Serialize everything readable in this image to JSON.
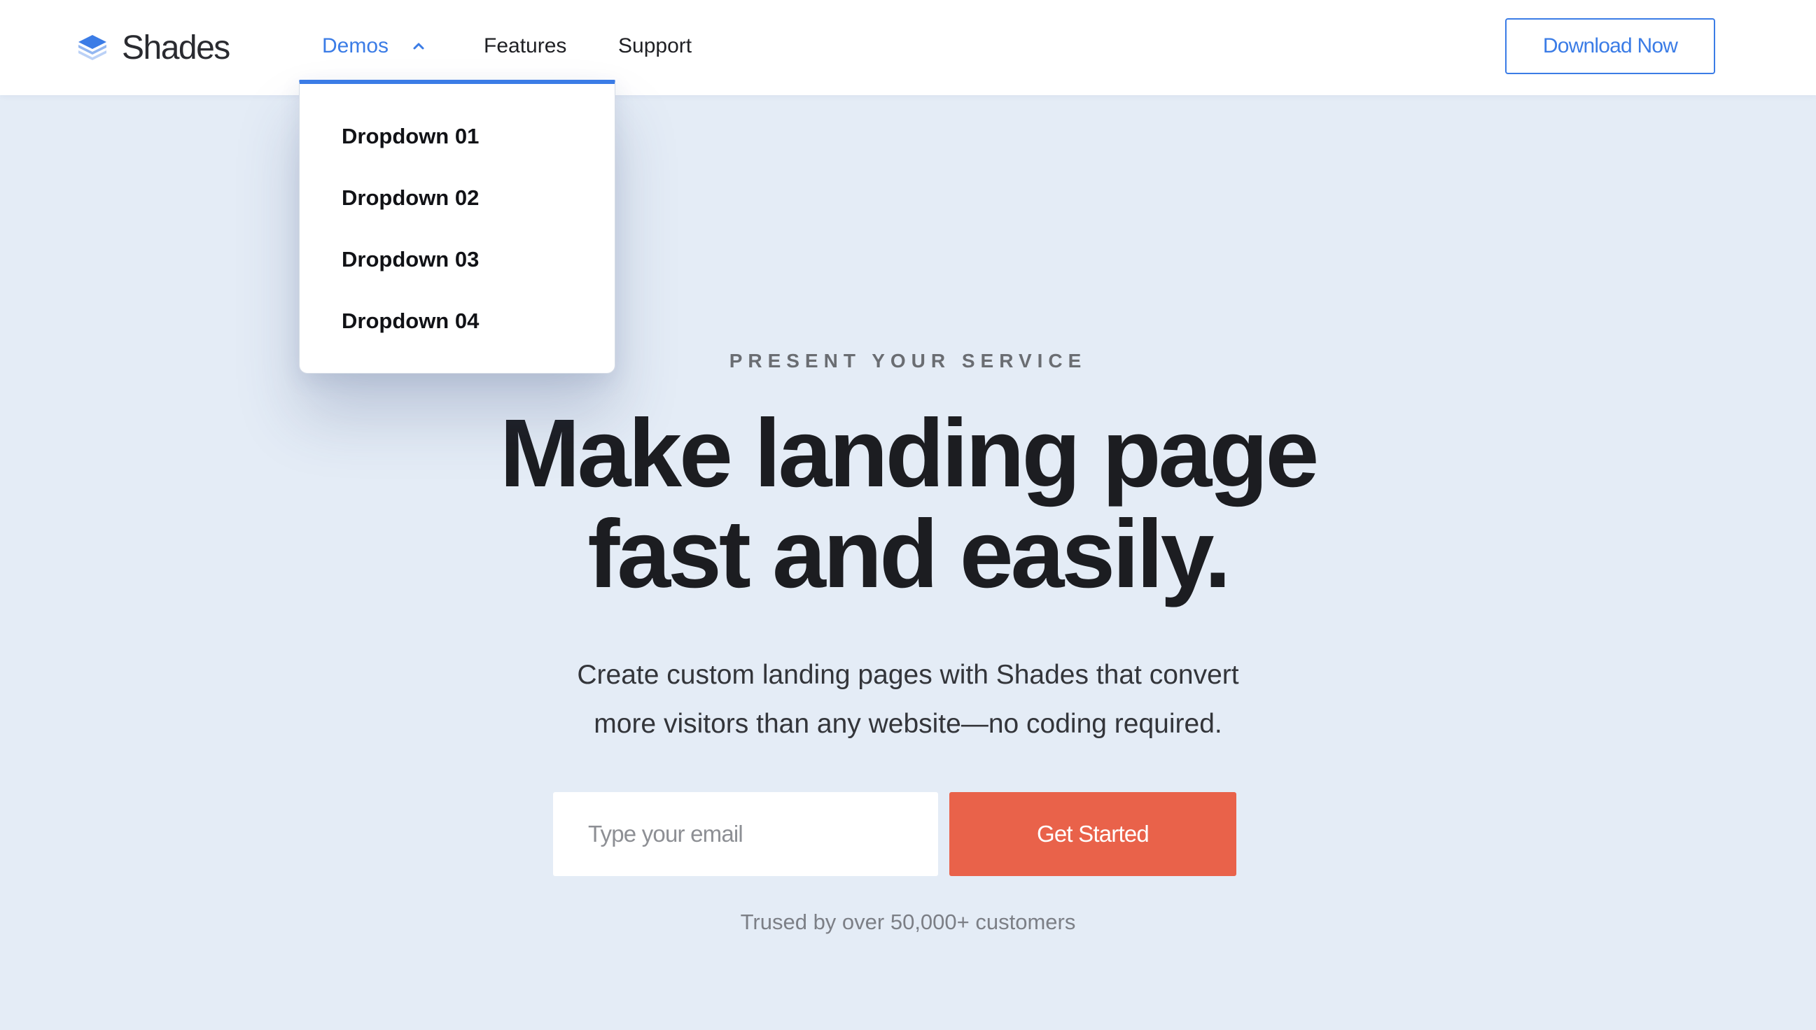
{
  "header": {
    "logo_text": "Shades",
    "nav": [
      {
        "label": "Demos",
        "active": true,
        "expanded": true
      },
      {
        "label": "Features"
      },
      {
        "label": "Support"
      }
    ],
    "cta_label": "Download Now"
  },
  "dropdown": {
    "items": [
      "Dropdown 01",
      "Dropdown 02",
      "Dropdown 03",
      "Dropdown 04"
    ]
  },
  "hero": {
    "eyebrow": "PRESENT YOUR SERVICE",
    "title_line1": "Make landing page",
    "title_line2": "fast and easily.",
    "subtitle_line1": "Create custom landing pages with Shades that convert",
    "subtitle_line2": "more visitors than any website—no coding required.",
    "email_placeholder": "Type your email",
    "button_label": "Get Started",
    "trusted_text": "Trused by over 50,000+ customers"
  },
  "colors": {
    "accent": "#3b7ce6",
    "cta": "#e9624a",
    "background": "#e4ecf6"
  },
  "icons": {
    "logo": "stacked-layers-icon",
    "demos_toggle": "chevron-up-icon"
  }
}
